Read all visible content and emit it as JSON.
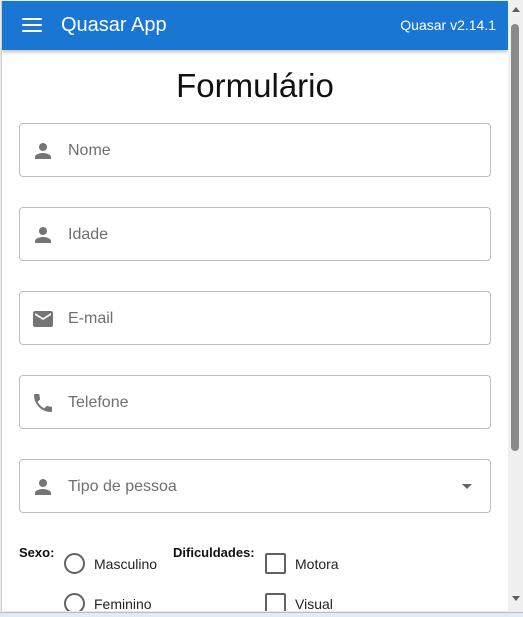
{
  "header": {
    "title": "Quasar App",
    "version": "Quasar v2.14.1",
    "color": "#1976d2"
  },
  "form": {
    "title": "Formulário",
    "fields": {
      "nome": {
        "placeholder": "Nome",
        "icon": "person-icon"
      },
      "idade": {
        "placeholder": "Idade",
        "icon": "person-icon"
      },
      "email": {
        "placeholder": "E-mail",
        "icon": "mail-icon"
      },
      "telefone": {
        "placeholder": "Telefone",
        "icon": "phone-icon"
      },
      "tipo": {
        "placeholder": "Tipo de pessoa",
        "icon": "person-icon"
      }
    },
    "sexo": {
      "label": "Sexo:",
      "options": [
        "Masculino",
        "Feminino"
      ]
    },
    "dificuldades": {
      "label": "Dificuldades:",
      "options": [
        "Motora",
        "Visual"
      ]
    }
  }
}
